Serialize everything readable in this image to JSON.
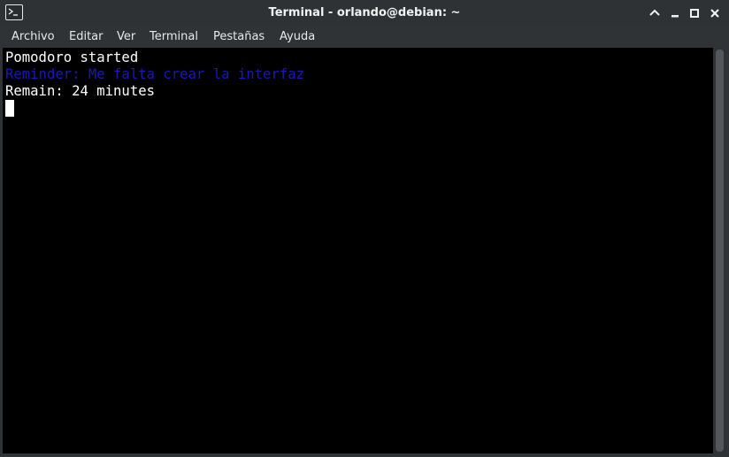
{
  "window": {
    "title": "Terminal - orlando@debian: ~"
  },
  "icons": {
    "app": "terminal-icon",
    "minimize": "chevron-up-icon",
    "shade": "minimize-icon",
    "maximize": "maximize-icon",
    "close": "close-icon"
  },
  "menu": {
    "items": [
      {
        "label": "Archivo"
      },
      {
        "label": "Editar"
      },
      {
        "label": "Ver"
      },
      {
        "label": "Terminal"
      },
      {
        "label": "Pestañas"
      },
      {
        "label": "Ayuda"
      }
    ]
  },
  "terminal": {
    "lines": [
      {
        "text": "Pomodoro started"
      },
      {
        "text": "Reminder: Me falta crear la interfaz"
      },
      {
        "text": "Remain: 24 minutes"
      }
    ]
  },
  "colors": {
    "titlebar": "#2f3235",
    "terminal_bg": "#000000",
    "terminal_fg": "#ffffff",
    "reminder_fg": "#1a18b8"
  }
}
